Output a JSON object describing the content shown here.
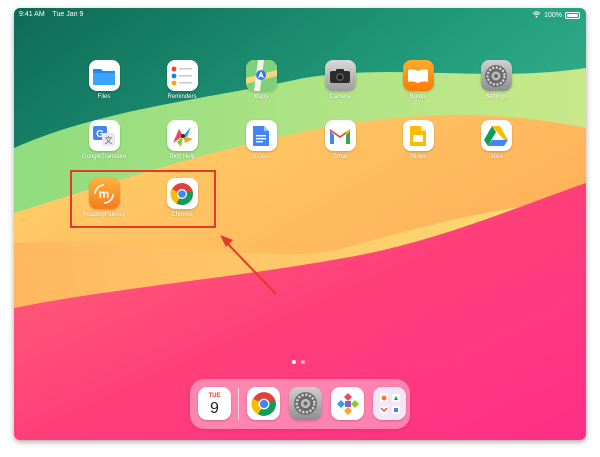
{
  "status_bar": {
    "time": "9:41 AM",
    "date": "Tue Jan 9",
    "battery": "100%"
  },
  "apps": [
    {
      "label": "Files",
      "icon": "files-icon"
    },
    {
      "label": "Reminders",
      "icon": "reminders-icon"
    },
    {
      "label": "Maps",
      "icon": "maps-icon"
    },
    {
      "label": "Camera",
      "icon": "camera-icon"
    },
    {
      "label": "Books",
      "icon": "books-icon"
    },
    {
      "label": "Settings",
      "icon": "settings-icon"
    },
    {
      "label": "GoogleTranslate",
      "icon": "google-translate-icon"
    },
    {
      "label": "Tech Help",
      "icon": "tech-help-icon"
    },
    {
      "label": "Docs",
      "icon": "docs-icon"
    },
    {
      "label": "Gmail",
      "icon": "gmail-icon"
    },
    {
      "label": "Slides",
      "icon": "slides-icon"
    },
    {
      "label": "Drive",
      "icon": "drive-icon"
    },
    {
      "label": "ReadingFluency",
      "icon": "reading-fluency-icon"
    },
    {
      "label": "Chrome",
      "icon": "chrome-icon"
    }
  ],
  "dock": {
    "calendar": {
      "weekday": "TUE",
      "day": "9"
    },
    "items": [
      "calendar-icon",
      "chrome-icon",
      "settings-icon",
      "app-icon",
      "folder-icon"
    ]
  },
  "page_dots": {
    "count": 2,
    "active": 1
  },
  "colors": {
    "highlight": "#e53a2b",
    "arrow": "#e53a2b"
  }
}
